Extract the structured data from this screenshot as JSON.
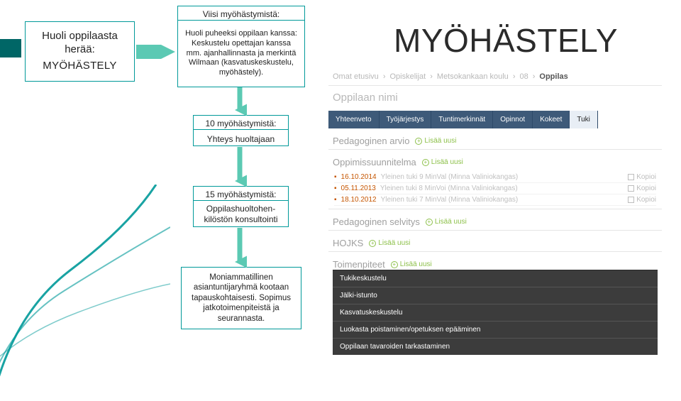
{
  "heading": "MYÖHÄSTELY",
  "flow": {
    "start": {
      "l1": "Huoli oppilaasta",
      "l2": "herää:",
      "l3": "MYÖHÄSTELY"
    },
    "step1": {
      "title": "Viisi myöhästymistä:",
      "body": "Huoli puheeksi oppilaan kanssa: Keskustelu opettajan kanssa mm. ajanhallinnasta ja merkintä Wilmaan (kasvatuskeskustelu, myöhästely)."
    },
    "step2": {
      "title": "10 myöhästymistä:",
      "body": "Yhteys huoltajaan"
    },
    "step3": {
      "title": "15 myöhästymistä:",
      "body": "Oppilashuoltohen-kilöstön konsultointi"
    },
    "step4": "Moniammatillinen asiantuntijaryhmä kootaan tapauskohtaisesti. Sopimus jatkotoimenpiteistä ja seurannasta."
  },
  "app": {
    "crumbs": [
      "Omat etusivu",
      "Opiskelijat",
      "Metsokankaan koulu",
      "08",
      "Oppilas"
    ],
    "nameLabel": "Oppilaan nimi",
    "tabs": [
      "Yhteenveto",
      "Työjärjestys",
      "Tuntimerkinnät",
      "Opinnot",
      "Kokeet",
      "Tuki"
    ],
    "activeTab": 5,
    "sections": {
      "pedArvio": {
        "title": "Pedagoginen arvio",
        "add": "Lisää uusi"
      },
      "oppi": {
        "title": "Oppimissuunnitelma",
        "add": "Lisää uusi",
        "entries": [
          {
            "date": "16.10.2014",
            "text": "Yleinen tuki 9 MinVal (Minna Valiniokangas)"
          },
          {
            "date": "05.11.2013",
            "text": "Yleinen tuki 8 MinVoi (Minna Valiniokangas)"
          },
          {
            "date": "18.10.2012",
            "text": "Yleinen tuki 7 MinVal (Minna Valiniokangas)"
          }
        ],
        "copy": "Kopioi"
      },
      "pedSel": {
        "title": "Pedagoginen selvitys",
        "add": "Lisää uusi"
      },
      "hojks": {
        "title": "HOJKS",
        "add": "Lisää uusi"
      },
      "toim": {
        "title": "Toimenpiteet",
        "add": "Lisää uusi",
        "menu": [
          "Tukikeskustelu",
          "Jälki-istunto",
          "Kasvatuskeskustelu",
          "Luokasta poistaminen/opetuksen epääminen",
          "Oppilaan tavaroiden tarkastaminen"
        ]
      }
    }
  }
}
